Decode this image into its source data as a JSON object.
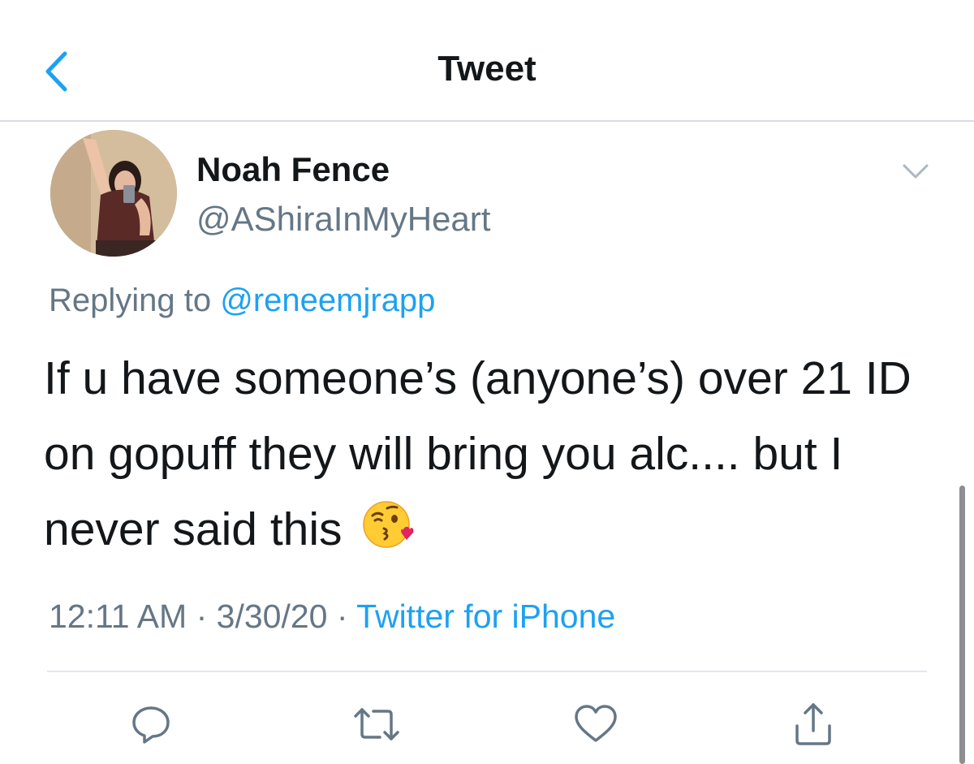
{
  "nav": {
    "title": "Tweet",
    "back_icon": "chevron-left-icon"
  },
  "tweet": {
    "author": {
      "name": "Noah Fence",
      "handle": "@AShiraInMyHeart"
    },
    "replying_label": "Replying to",
    "replying_to": "@reneemjrapp",
    "text": "If u have someone’s (anyone’s) over 21 ID on gopuff they will bring you alc.... but I never said this",
    "emoji": "face-blowing-a-kiss",
    "time": "12:11 AM",
    "separator": "·",
    "date": "3/30/20",
    "source": "Twitter for iPhone"
  },
  "actions": [
    {
      "name": "reply",
      "icon": "comment-icon"
    },
    {
      "name": "retweet",
      "icon": "retweet-icon"
    },
    {
      "name": "like",
      "icon": "heart-icon"
    },
    {
      "name": "share",
      "icon": "share-icon"
    }
  ],
  "colors": {
    "accent": "#1da1f2",
    "text_primary": "#14171a",
    "text_secondary": "#657786",
    "icon_gray": "#657786",
    "divider": "#e1e8ed"
  }
}
